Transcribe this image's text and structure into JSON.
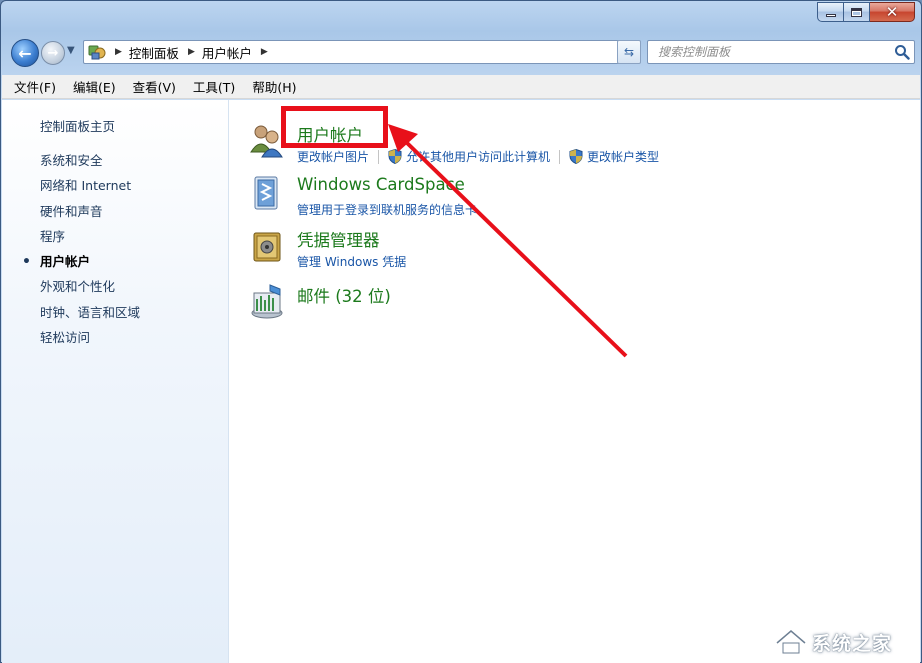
{
  "breadcrumb": {
    "items": [
      "控制面板",
      "用户帐户"
    ]
  },
  "search": {
    "placeholder": "搜索控制面板"
  },
  "menu": {
    "items": [
      "文件(F)",
      "编辑(E)",
      "查看(V)",
      "工具(T)",
      "帮助(H)"
    ]
  },
  "sidebar": {
    "home": "控制面板主页",
    "items": [
      {
        "label": "系统和安全",
        "active": false
      },
      {
        "label": "网络和 Internet",
        "active": false
      },
      {
        "label": "硬件和声音",
        "active": false
      },
      {
        "label": "程序",
        "active": false
      },
      {
        "label": "用户帐户",
        "active": true
      },
      {
        "label": "外观和个性化",
        "active": false
      },
      {
        "label": "时钟、语言和区域",
        "active": false
      },
      {
        "label": "轻松访问",
        "active": false
      }
    ]
  },
  "categories": {
    "user_accounts": {
      "title": "用户帐户",
      "links": [
        "更改帐户图片",
        "允许其他用户访问此计算机",
        "更改帐户类型"
      ]
    },
    "cardspace": {
      "title": "Windows CardSpace",
      "links": [
        "管理用于登录到联机服务的信息卡"
      ]
    },
    "credentials": {
      "title": "凭据管理器",
      "links": [
        "管理 Windows 凭据"
      ]
    },
    "mail": {
      "title": "邮件 (32 位)"
    }
  },
  "annotation": {
    "color": "#e8101a"
  },
  "watermark": {
    "text": "系统之家"
  }
}
